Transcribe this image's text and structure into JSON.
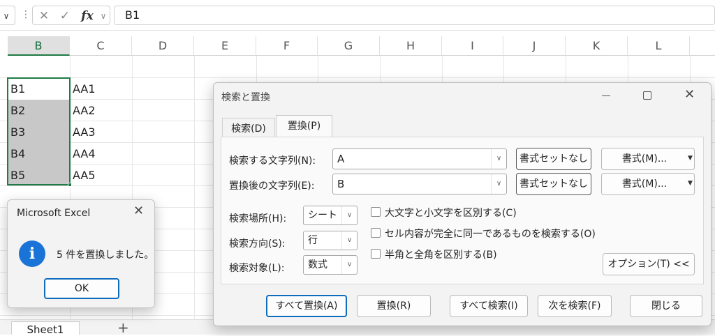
{
  "formula_bar": {
    "name_box_arrow": "chevron-down-icon",
    "cancel_icon": "✕",
    "enter_icon": "✓",
    "fx_label": "fx",
    "value": "B1"
  },
  "grid": {
    "columns": [
      "B",
      "C",
      "D",
      "E",
      "F",
      "G",
      "H",
      "I",
      "J",
      "K",
      "L"
    ],
    "selected_column": "B",
    "cells_b": [
      "B1",
      "B2",
      "B3",
      "B4",
      "B5"
    ],
    "cells_c": [
      "AA1",
      "AA2",
      "AA3",
      "AA4",
      "AA5"
    ],
    "selection_color": "#1f7a45"
  },
  "sheet_tabs": {
    "tabs": [
      "Sheet1"
    ],
    "add_label": "+"
  },
  "dialog": {
    "title": "検索と置換",
    "tabs": [
      {
        "label": "検索(D)",
        "active": false
      },
      {
        "label": "置換(P)",
        "active": true
      }
    ],
    "find_label": "検索する文字列(N):",
    "find_value": "A",
    "replace_label": "置換後の文字列(E):",
    "replace_value": "B",
    "format_unset_1": "書式セットなし",
    "format_unset_2": "書式セットなし",
    "format_btn_1": "書式(M)...",
    "format_btn_2": "書式(M)...",
    "within_label": "検索場所(H):",
    "within_value": "シート",
    "search_label": "検索方向(S):",
    "search_value": "行",
    "lookin_label": "検索対象(L):",
    "lookin_value": "数式",
    "opt_case": "大文字と小文字を区別する(C)",
    "opt_entire": "セル内容が完全に同一であるものを検索する(O)",
    "opt_width": "半角と全角を区別する(B)",
    "options_btn": "オプション(T) <<",
    "buttons": {
      "replace_all": "すべて置換(A)",
      "replace": "置換(R)",
      "find_all": "すべて検索(I)",
      "find_next": "次を検索(F)",
      "close": "閉じる"
    }
  },
  "message_box": {
    "title": "Microsoft Excel",
    "icon": "info-icon",
    "message": "5 件を置換しました。",
    "ok": "OK"
  }
}
